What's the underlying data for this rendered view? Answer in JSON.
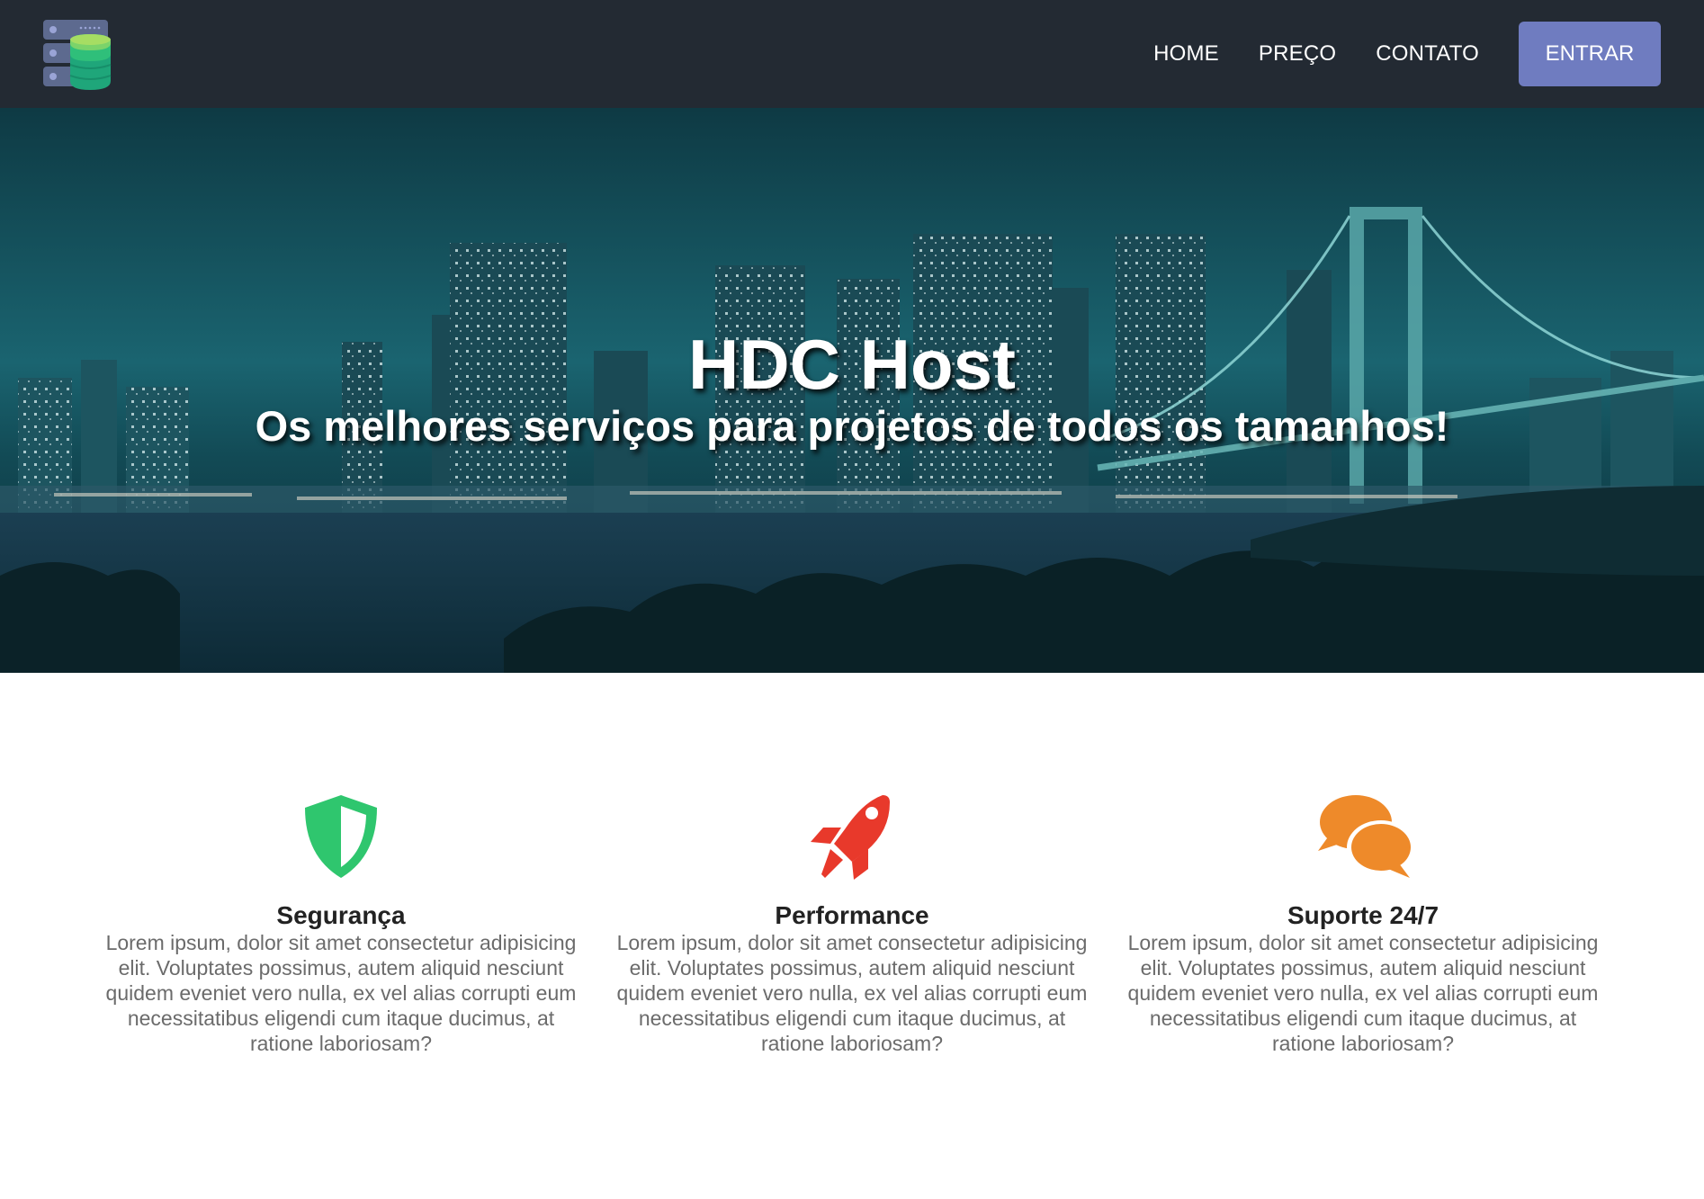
{
  "header": {
    "logo_icon": "server-database-icon",
    "nav": [
      {
        "label": "HOME"
      },
      {
        "label": "PREÇO"
      },
      {
        "label": "CONTATO"
      }
    ],
    "login_label": "ENTRAR",
    "login_color": "#6f7cc0",
    "background": "#232a33"
  },
  "hero": {
    "title": "HDC Host",
    "subtitle": "Os melhores serviços para projetos de todos os tamanhos!"
  },
  "features": [
    {
      "icon": "shield-icon",
      "icon_color": "#2fc66e",
      "title": "Segurança",
      "text": "Lorem ipsum, dolor sit amet consectetur adipisicing elit. Voluptates possimus, autem aliquid nesciunt quidem eveniet vero nulla, ex vel alias corrupti eum necessitatibus eligendi cum itaque ducimus, at ratione laboriosam?"
    },
    {
      "icon": "rocket-icon",
      "icon_color": "#e8392b",
      "title": "Performance",
      "text": "Lorem ipsum, dolor sit amet consectetur adipisicing elit. Voluptates possimus, autem aliquid nesciunt quidem eveniet vero nulla, ex vel alias corrupti eum necessitatibus eligendi cum itaque ducimus, at ratione laboriosam?"
    },
    {
      "icon": "chat-bubbles-icon",
      "icon_color": "#ee8a2a",
      "title": "Suporte 24/7",
      "text": "Lorem ipsum, dolor sit amet consectetur adipisicing elit. Voluptates possimus, autem aliquid nesciunt quidem eveniet vero nulla, ex vel alias corrupti eum necessitatibus eligendi cum itaque ducimus, at ratione laboriosam?"
    }
  ]
}
